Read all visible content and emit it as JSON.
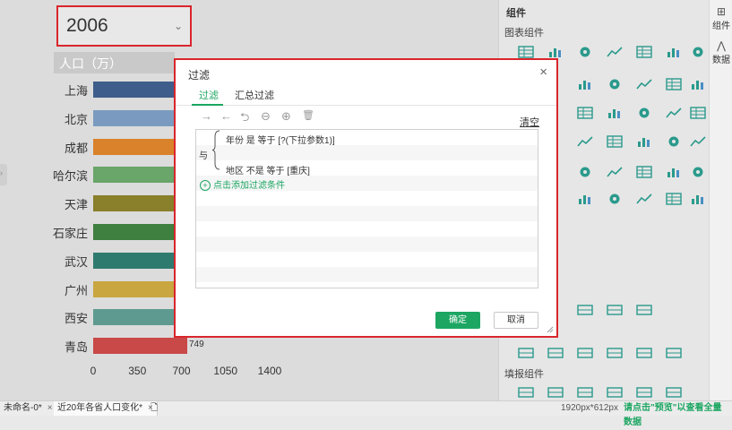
{
  "canvas": {
    "year_select": {
      "value": "2006"
    },
    "chart_title": "人口（万）"
  },
  "chart_data": {
    "type": "bar",
    "orientation": "horizontal",
    "title": "人口（万）",
    "categories": [
      "上海",
      "北京",
      "成都",
      "哈尔滨",
      "天津",
      "石家庄",
      "武汉",
      "广州",
      "西安",
      "青岛"
    ],
    "values": [
      1360,
      1500,
      1100,
      980,
      950,
      940,
      830,
      1000,
      780,
      749
    ],
    "value_labels": {
      "9": "749"
    },
    "xticks": [
      "0",
      "350",
      "700",
      "1050",
      "1400"
    ],
    "xlim": [
      0,
      1400
    ],
    "colors": [
      "#3f5d8a",
      "#7a9bbf",
      "#d9822b",
      "#6aa56a",
      "#8a7f2a",
      "#3f7f3f",
      "#2f7a6e",
      "#c9a640",
      "#5e9a8f",
      "#c94848"
    ]
  },
  "right_panel": {
    "header_icon": "▤",
    "header": "组件",
    "section_chart": "图表组件",
    "section_fill": "填报组件"
  },
  "far_tabs": {
    "components_label": "组件",
    "data_label": "数据"
  },
  "status_bar": {
    "tab1": "未命名-0*",
    "tab2": "近20年各省人口变化*",
    "close_glyph": "×",
    "dimensions": "1920px*612px",
    "hint": "请点击\"预览\"以查看全量数据"
  },
  "dialog": {
    "title": "过滤",
    "close_glyph": "×",
    "tabs": [
      "过滤",
      "汇总过滤"
    ],
    "toolbar": [
      "→",
      "←",
      "⮌",
      "⊖",
      "⊕",
      "🗑"
    ],
    "clear_label": "清空",
    "and_label": "与",
    "conditions": [
      "年份 是 等于 [?(下拉参数1)]",
      "地区 不是 等于 [重庆]"
    ],
    "add_condition_plus": "+",
    "add_condition": "点击添加过滤条件",
    "ok_label": "确定",
    "cancel_label": "取消"
  },
  "colors": {
    "accent": "#1ca662",
    "highlight_border": "#d9262c",
    "icon_teal": "#2a9a8c"
  }
}
